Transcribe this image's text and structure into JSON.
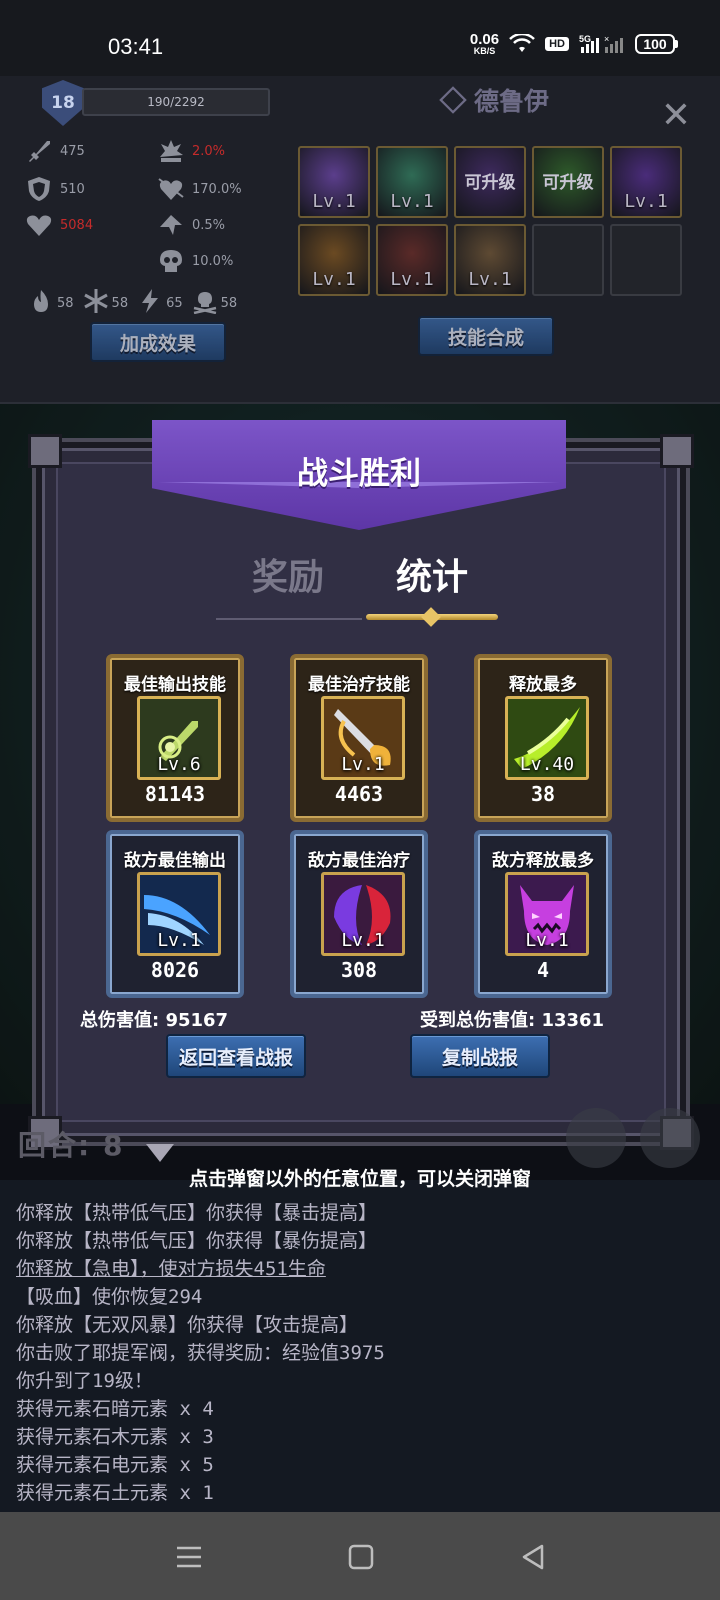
{
  "status_bar": {
    "time": "03:41",
    "net_speed": "0.06",
    "net_unit": "KB/S",
    "hd": "HD",
    "network": "5G",
    "battery": "100"
  },
  "character": {
    "level": "18",
    "xp": "190/2292",
    "name": "德鲁伊",
    "stats": {
      "attack": "475",
      "crit_rate": "2.0%",
      "defense": "510",
      "crit_damage": "170.0%",
      "hp": "5084",
      "lifesteal": "0.5%",
      "dodge": "10.0%"
    },
    "elements": {
      "fire": "58",
      "ice": "58",
      "lightning": "65",
      "death": "58"
    },
    "bonus_button": "加成效果",
    "merge_button": "技能合成",
    "skills": [
      {
        "label": "Lv.1",
        "color": "#5b3e8c"
      },
      {
        "label": "Lv.1",
        "color": "#2f6b55"
      },
      {
        "label": "可升级",
        "color": "#3e2a5e"
      },
      {
        "label": "可升级",
        "color": "#2e5a2a"
      },
      {
        "label": "Lv.1",
        "color": "#4a2c7a"
      },
      {
        "label": "Lv.1",
        "color": "#6b4a22"
      },
      {
        "label": "Lv.1",
        "color": "#5a2a28"
      },
      {
        "label": "Lv.1",
        "color": "#5e4a33"
      },
      {
        "label": "",
        "color": ""
      },
      {
        "label": "",
        "color": ""
      }
    ]
  },
  "modal": {
    "title": "战斗胜利",
    "tabs": {
      "rewards": "奖励",
      "stats": "统计"
    },
    "cards": [
      {
        "title": "最佳输出技能",
        "level": "Lv.6",
        "value": "81143",
        "style": "gold",
        "icon": "green-sword-icon",
        "color": "#2d3a1e"
      },
      {
        "title": "最佳治疗技能",
        "level": "Lv.1",
        "value": "4463",
        "style": "gold",
        "icon": "golden-blade-icon",
        "color": "#5a3a16"
      },
      {
        "title": "释放最多",
        "level": "Lv.40",
        "value": "38",
        "style": "gold",
        "icon": "green-slash-icon",
        "color": "#2f4a12"
      },
      {
        "title": "敌方最佳输出",
        "level": "Lv.1",
        "value": "8026",
        "style": "blue",
        "icon": "blue-slash-icon",
        "color": "#13294e"
      },
      {
        "title": "敌方最佳治疗",
        "level": "Lv.1",
        "value": "308",
        "style": "blue",
        "icon": "purple-red-wings-icon",
        "color": "#3a1a3e"
      },
      {
        "title": "敌方释放最多",
        "level": "Lv.1",
        "value": "4",
        "style": "blue",
        "icon": "purple-demon-icon",
        "color": "#3c1a4e"
      }
    ],
    "total_damage": "总伤害值: 95167",
    "total_received": "受到总伤害值: 13361",
    "report_button": "返回查看战报",
    "copy_button": "复制战报"
  },
  "round_label": "回合: 8",
  "hint": "点击弹窗以外的任意位置，可以关闭弹窗",
  "log": [
    "你释放【热带低气压】你获得【暴击提高】",
    "你释放【热带低气压】你获得【暴伤提高】",
    "你释放【急电】，使对方损失451生命",
    "【吸血】使你恢复294",
    "你释放【无双风暴】你获得【攻击提高】",
    "你击败了耶提军阀，获得奖励：经验值3975",
    "你升到了19级！",
    "获得元素石暗元素 x 4",
    "获得元素石木元素 x 3",
    "获得元素石电元素 x 5",
    "获得元素石土元素 x 1"
  ]
}
